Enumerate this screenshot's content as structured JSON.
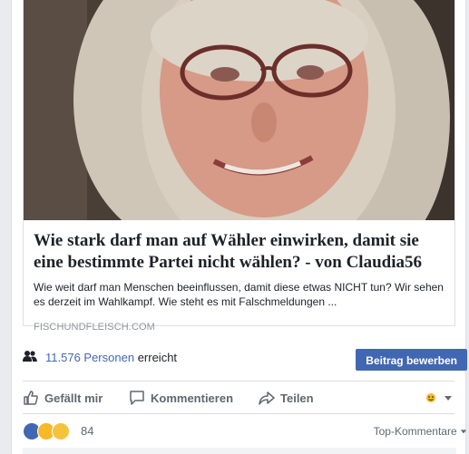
{
  "post": {
    "link_preview": {
      "headline": "Wie stark darf man auf Wähler einwirken, damit sie eine bestimmte Partei nicht wählen? - von Claudia56",
      "description": "Wie weit darf man Menschen beeinflussen, damit diese etwas NICHT tun? Wir sehen es derzeit im Wahlkampf. Wie steht es mit Falschmeldungen ...",
      "domain": "FISCHUNDFLEISCH.COM"
    },
    "reach": {
      "count_text": "11.576 Personen",
      "suffix": "erreicht"
    },
    "boost_label": "Beitrag bewerben",
    "actions": {
      "like": "Gefällt mir",
      "comment": "Kommentieren",
      "share": "Teilen"
    },
    "reactions": {
      "count": "84",
      "types": [
        "like",
        "sad",
        "haha"
      ],
      "sort_label": "Top-Kommentare"
    }
  },
  "colors": {
    "brand_blue": "#4267b2",
    "text": "#1d2129",
    "secondary_text": "#606770",
    "page_bg": "#e9ebee"
  },
  "icons": [
    "group-icon",
    "like-thumb-icon",
    "comment-bubble-icon",
    "share-arrow-icon",
    "audience-smiley-icon",
    "dropdown-caret-icon",
    "like-reaction-icon",
    "sad-reaction-icon",
    "haha-reaction-icon"
  ]
}
